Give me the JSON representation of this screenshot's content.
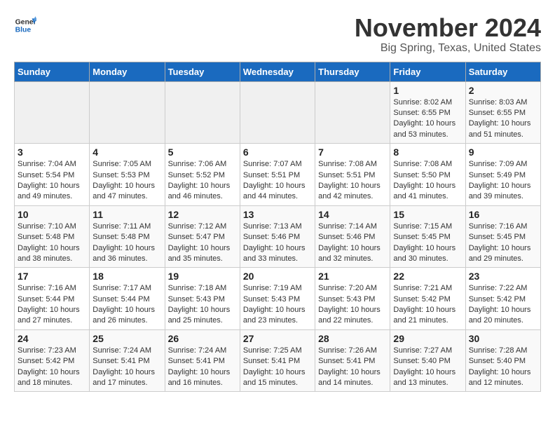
{
  "app": {
    "name_line1": "General",
    "name_line2": "Blue"
  },
  "header": {
    "month_title": "November 2024",
    "location": "Big Spring, Texas, United States"
  },
  "days_of_week": [
    "Sunday",
    "Monday",
    "Tuesday",
    "Wednesday",
    "Thursday",
    "Friday",
    "Saturday"
  ],
  "weeks": [
    [
      {
        "day": "",
        "info": ""
      },
      {
        "day": "",
        "info": ""
      },
      {
        "day": "",
        "info": ""
      },
      {
        "day": "",
        "info": ""
      },
      {
        "day": "",
        "info": ""
      },
      {
        "day": "1",
        "info": "Sunrise: 8:02 AM\nSunset: 6:55 PM\nDaylight: 10 hours\nand 53 minutes."
      },
      {
        "day": "2",
        "info": "Sunrise: 8:03 AM\nSunset: 6:55 PM\nDaylight: 10 hours\nand 51 minutes."
      }
    ],
    [
      {
        "day": "3",
        "info": "Sunrise: 7:04 AM\nSunset: 5:54 PM\nDaylight: 10 hours\nand 49 minutes."
      },
      {
        "day": "4",
        "info": "Sunrise: 7:05 AM\nSunset: 5:53 PM\nDaylight: 10 hours\nand 47 minutes."
      },
      {
        "day": "5",
        "info": "Sunrise: 7:06 AM\nSunset: 5:52 PM\nDaylight: 10 hours\nand 46 minutes."
      },
      {
        "day": "6",
        "info": "Sunrise: 7:07 AM\nSunset: 5:51 PM\nDaylight: 10 hours\nand 44 minutes."
      },
      {
        "day": "7",
        "info": "Sunrise: 7:08 AM\nSunset: 5:51 PM\nDaylight: 10 hours\nand 42 minutes."
      },
      {
        "day": "8",
        "info": "Sunrise: 7:08 AM\nSunset: 5:50 PM\nDaylight: 10 hours\nand 41 minutes."
      },
      {
        "day": "9",
        "info": "Sunrise: 7:09 AM\nSunset: 5:49 PM\nDaylight: 10 hours\nand 39 minutes."
      }
    ],
    [
      {
        "day": "10",
        "info": "Sunrise: 7:10 AM\nSunset: 5:48 PM\nDaylight: 10 hours\nand 38 minutes."
      },
      {
        "day": "11",
        "info": "Sunrise: 7:11 AM\nSunset: 5:48 PM\nDaylight: 10 hours\nand 36 minutes."
      },
      {
        "day": "12",
        "info": "Sunrise: 7:12 AM\nSunset: 5:47 PM\nDaylight: 10 hours\nand 35 minutes."
      },
      {
        "day": "13",
        "info": "Sunrise: 7:13 AM\nSunset: 5:46 PM\nDaylight: 10 hours\nand 33 minutes."
      },
      {
        "day": "14",
        "info": "Sunrise: 7:14 AM\nSunset: 5:46 PM\nDaylight: 10 hours\nand 32 minutes."
      },
      {
        "day": "15",
        "info": "Sunrise: 7:15 AM\nSunset: 5:45 PM\nDaylight: 10 hours\nand 30 minutes."
      },
      {
        "day": "16",
        "info": "Sunrise: 7:16 AM\nSunset: 5:45 PM\nDaylight: 10 hours\nand 29 minutes."
      }
    ],
    [
      {
        "day": "17",
        "info": "Sunrise: 7:16 AM\nSunset: 5:44 PM\nDaylight: 10 hours\nand 27 minutes."
      },
      {
        "day": "18",
        "info": "Sunrise: 7:17 AM\nSunset: 5:44 PM\nDaylight: 10 hours\nand 26 minutes."
      },
      {
        "day": "19",
        "info": "Sunrise: 7:18 AM\nSunset: 5:43 PM\nDaylight: 10 hours\nand 25 minutes."
      },
      {
        "day": "20",
        "info": "Sunrise: 7:19 AM\nSunset: 5:43 PM\nDaylight: 10 hours\nand 23 minutes."
      },
      {
        "day": "21",
        "info": "Sunrise: 7:20 AM\nSunset: 5:43 PM\nDaylight: 10 hours\nand 22 minutes."
      },
      {
        "day": "22",
        "info": "Sunrise: 7:21 AM\nSunset: 5:42 PM\nDaylight: 10 hours\nand 21 minutes."
      },
      {
        "day": "23",
        "info": "Sunrise: 7:22 AM\nSunset: 5:42 PM\nDaylight: 10 hours\nand 20 minutes."
      }
    ],
    [
      {
        "day": "24",
        "info": "Sunrise: 7:23 AM\nSunset: 5:42 PM\nDaylight: 10 hours\nand 18 minutes."
      },
      {
        "day": "25",
        "info": "Sunrise: 7:24 AM\nSunset: 5:41 PM\nDaylight: 10 hours\nand 17 minutes."
      },
      {
        "day": "26",
        "info": "Sunrise: 7:24 AM\nSunset: 5:41 PM\nDaylight: 10 hours\nand 16 minutes."
      },
      {
        "day": "27",
        "info": "Sunrise: 7:25 AM\nSunset: 5:41 PM\nDaylight: 10 hours\nand 15 minutes."
      },
      {
        "day": "28",
        "info": "Sunrise: 7:26 AM\nSunset: 5:41 PM\nDaylight: 10 hours\nand 14 minutes."
      },
      {
        "day": "29",
        "info": "Sunrise: 7:27 AM\nSunset: 5:40 PM\nDaylight: 10 hours\nand 13 minutes."
      },
      {
        "day": "30",
        "info": "Sunrise: 7:28 AM\nSunset: 5:40 PM\nDaylight: 10 hours\nand 12 minutes."
      }
    ]
  ]
}
